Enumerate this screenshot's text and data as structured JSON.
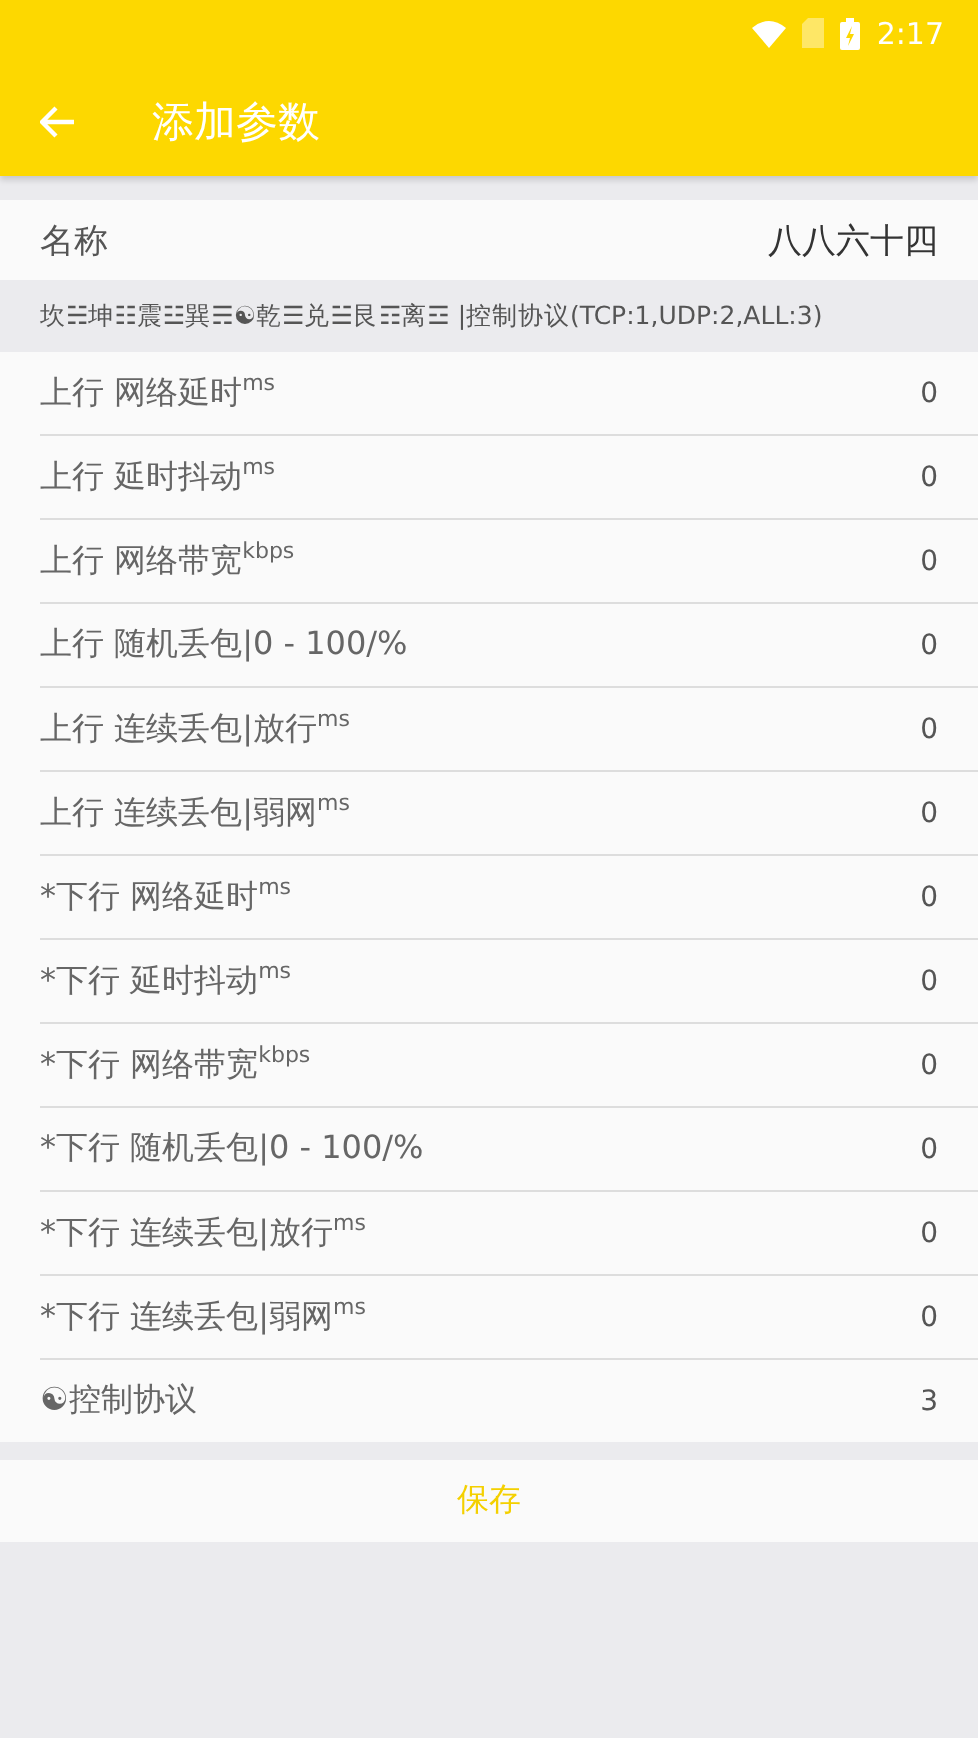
{
  "status_bar": {
    "time": "2:17"
  },
  "toolbar": {
    "title": "添加参数"
  },
  "name_field": {
    "label": "名称",
    "value": "八八六十四"
  },
  "hint": "坎☵坤☷震☳巽☴☯乾☰兑☱艮☶离☲ |控制协议(TCP:1,UDP:2,ALL:3)",
  "params": [
    {
      "label": "上行 网络延时$^{ms}$",
      "value": "0"
    },
    {
      "label": "上行 延时抖动$^{ms}$",
      "value": "0"
    },
    {
      "label": "上行 网络带宽$^{kbps}$",
      "value": "0"
    },
    {
      "label": "上行 随机丢包|0 - 100/%",
      "value": "0"
    },
    {
      "label": "上行 连续丢包|放行$^{ms}$",
      "value": "0"
    },
    {
      "label": "上行 连续丢包|弱网$^{ms}$",
      "value": "0"
    },
    {
      "label": "*下行 网络延时$^{ms}$",
      "value": "0"
    },
    {
      "label": "*下行 延时抖动$^{ms}$",
      "value": "0"
    },
    {
      "label": "*下行 网络带宽$^{kbps}$",
      "value": "0"
    },
    {
      "label": "*下行 随机丢包|0 - 100/%",
      "value": "0"
    },
    {
      "label": "*下行 连续丢包|放行$^{ms}$",
      "value": "0"
    },
    {
      "label": "*下行 连续丢包|弱网$^{ms}$",
      "value": "0"
    },
    {
      "label": "☯控制协议",
      "value": "3"
    }
  ],
  "save_button": "保存"
}
